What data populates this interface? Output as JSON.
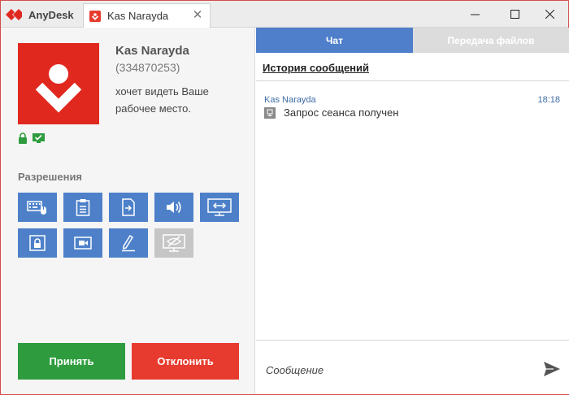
{
  "app": {
    "name": "AnyDesk"
  },
  "tab": {
    "label": "Kas Narayda",
    "close_glyph": "✕"
  },
  "window_controls": {
    "minimize": "—",
    "maximize": "☐",
    "close": "✕"
  },
  "peer": {
    "name": "Kas Narayda",
    "id": "(334870253)",
    "message": "хочет видеть Ваше рабочее место."
  },
  "permissions": {
    "heading": "Разрешения",
    "items": [
      {
        "name": "keyboard-mouse",
        "icon": "keyboard-mouse-icon",
        "enabled": true
      },
      {
        "name": "clipboard",
        "icon": "clipboard-icon",
        "enabled": true
      },
      {
        "name": "file-transfer",
        "icon": "file-transfer-icon",
        "enabled": true
      },
      {
        "name": "sound",
        "icon": "speaker-icon",
        "enabled": true
      },
      {
        "name": "remote-control",
        "icon": "screen-arrows-icon",
        "enabled": true
      },
      {
        "name": "lock-screen",
        "icon": "lock-screen-icon",
        "enabled": true
      },
      {
        "name": "record",
        "icon": "camera-icon",
        "enabled": true
      },
      {
        "name": "draw",
        "icon": "pen-icon",
        "enabled": true
      },
      {
        "name": "privacy",
        "icon": "eye-slash-icon",
        "enabled": false
      }
    ]
  },
  "actions": {
    "accept": "Принять",
    "decline": "Отклонить"
  },
  "chat": {
    "tabs": {
      "chat": "Чат",
      "files": "Передача файлов"
    },
    "history_title": "История сообщений",
    "messages": [
      {
        "sender": "Kas Narayda",
        "time": "18:18",
        "text": "Запрос сеанса получен"
      }
    ],
    "compose_placeholder": "Сообщение"
  },
  "colors": {
    "brand_red": "#e1281f",
    "accent_blue": "#4f7fcb",
    "accept_green": "#2e9c3e",
    "decline_red": "#e63b2e"
  }
}
